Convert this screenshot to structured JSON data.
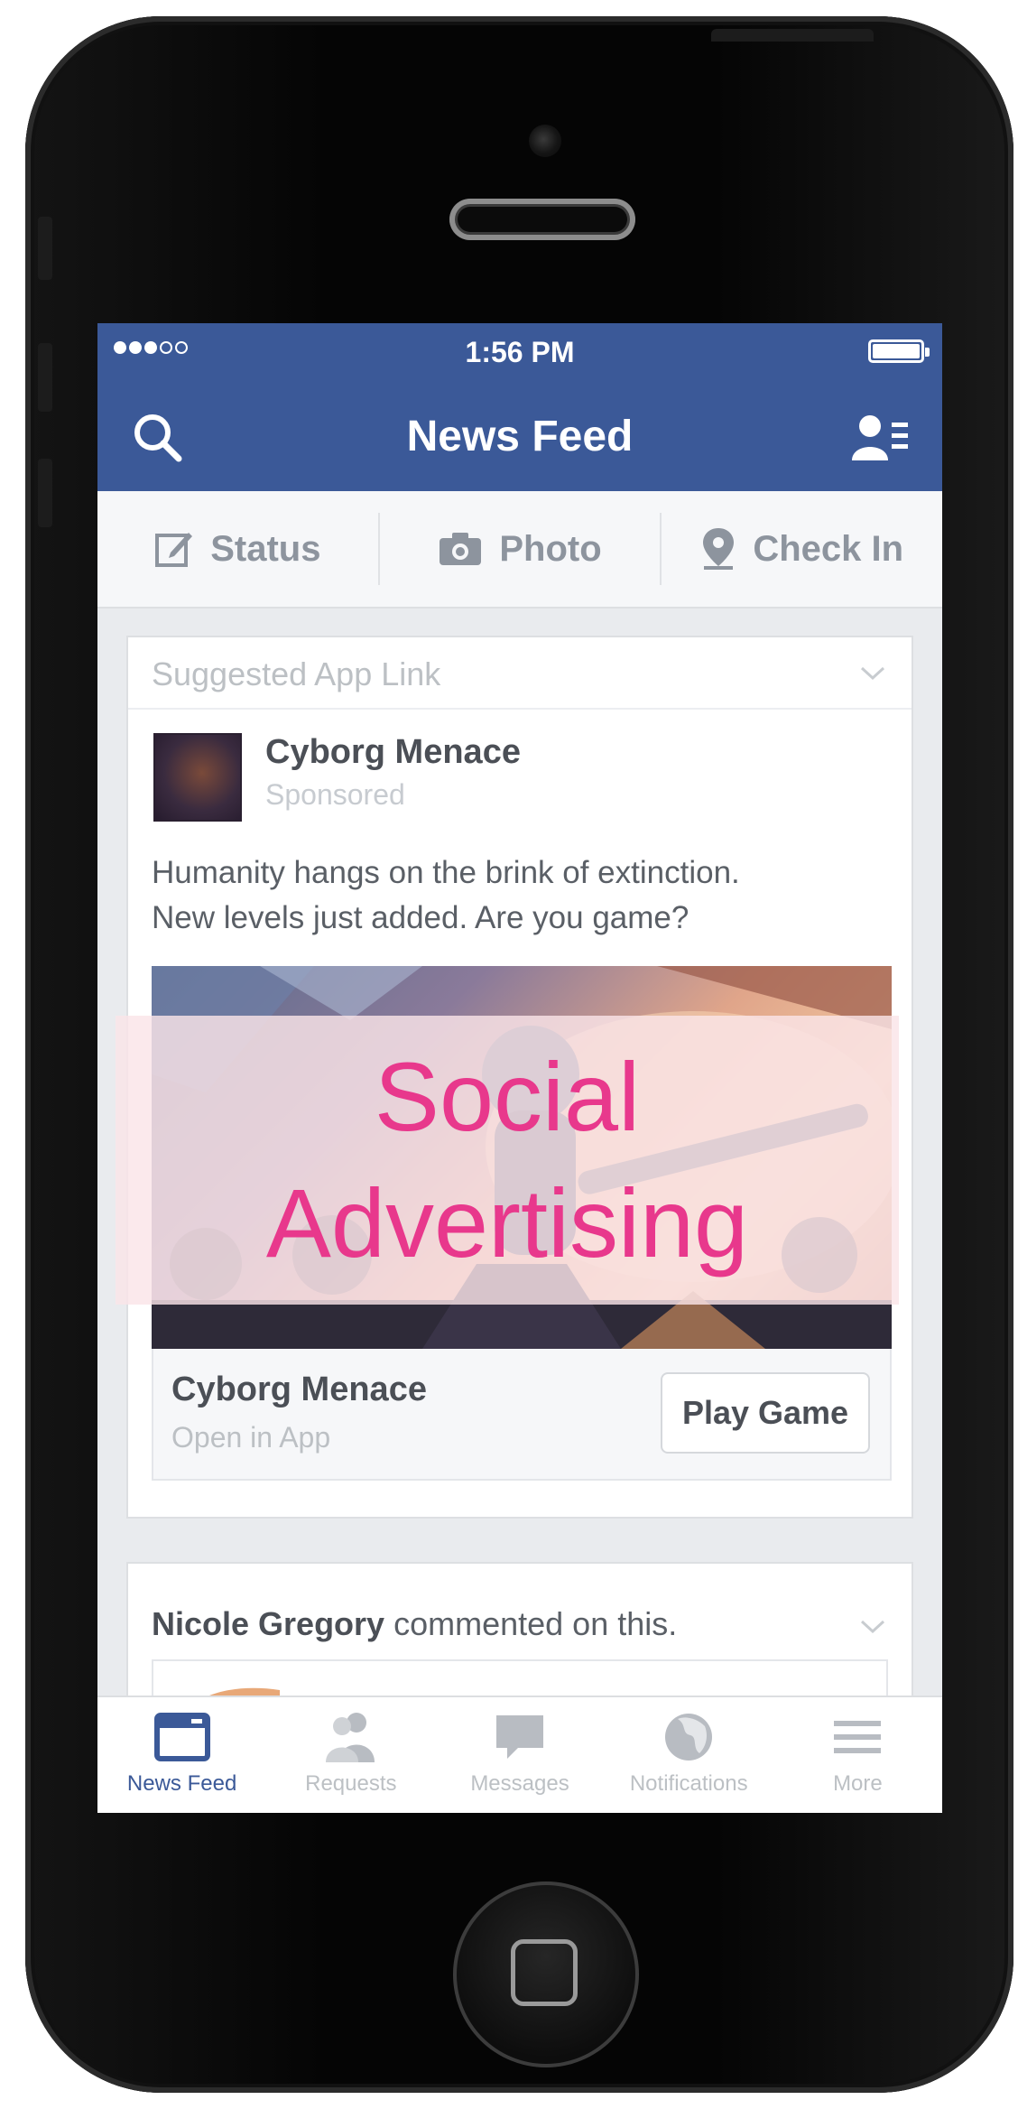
{
  "status_bar": {
    "time": "1:56 PM"
  },
  "nav": {
    "title": "News Feed"
  },
  "composer": {
    "items": [
      {
        "label": "Status",
        "icon": "edit-icon"
      },
      {
        "label": "Photo",
        "icon": "camera-icon"
      },
      {
        "label": "Check In",
        "icon": "location-pin-icon"
      }
    ]
  },
  "ad_card": {
    "header": "Suggested App Link",
    "page_name": "Cyborg Menace",
    "sponsored": "Sponsored",
    "text_line1": "Humanity hangs on the brink of extinction.",
    "text_line2": "New levels just added. Are you game?",
    "app_title": "Cyborg Menace",
    "app_subtitle": "Open in App",
    "cta": "Play Game"
  },
  "overlay": {
    "line1": "Social",
    "line2": "Advertising",
    "color": "#e8388c"
  },
  "second_card": {
    "author": "Nicole Gregory",
    "action": " commented on this."
  },
  "tabs": [
    {
      "label": "News Feed",
      "icon": "news-feed-icon",
      "active": true
    },
    {
      "label": "Requests",
      "icon": "requests-icon",
      "active": false
    },
    {
      "label": "Messages",
      "icon": "messages-icon",
      "active": false
    },
    {
      "label": "Notifications",
      "icon": "globe-icon",
      "active": false
    },
    {
      "label": "More",
      "icon": "menu-icon",
      "active": false
    }
  ],
  "colors": {
    "brand": "#3b5998",
    "background": "#e9ebee"
  }
}
